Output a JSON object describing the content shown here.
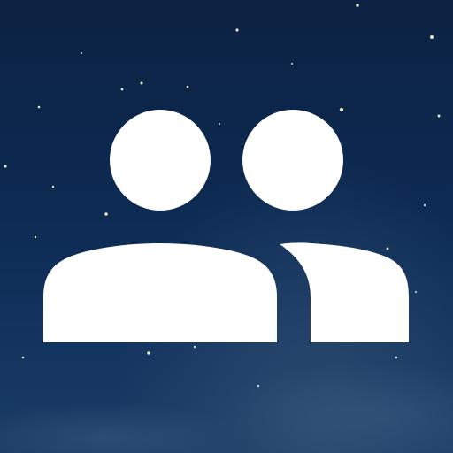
{
  "app_icon": {
    "icon": "people-group-icon",
    "background": "night-sky-stars",
    "colors": {
      "sky_top": "#0c2243",
      "sky_bottom": "#1a3d66",
      "glyph": "#ffffff",
      "star": "#e8e6c8"
    }
  }
}
